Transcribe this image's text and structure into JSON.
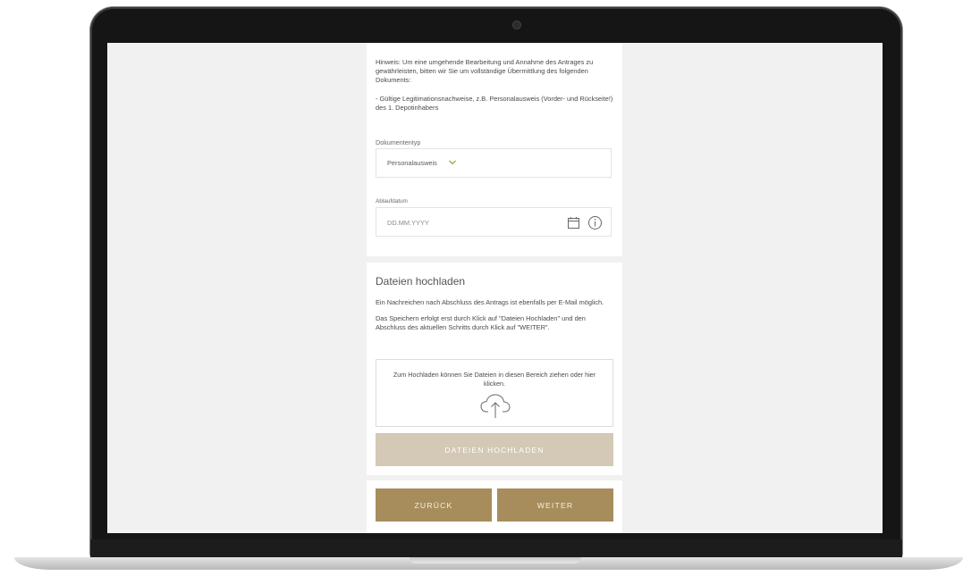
{
  "notice": {
    "paragraph1": "Hinweis: Um eine umgehende Bearbeitung und Annahme des Antrages zu gewährleisten, bitten wir Sie um vollständige Übermittlung des folgenden Dokuments:",
    "paragraph2": "- Gültige Legitimationsnachweise, z.B. Personalausweis (Vorder- und Rückseite!) des 1. Depotinhabers"
  },
  "document_type": {
    "label": "Dokumententyp",
    "selected": "Personalausweis"
  },
  "expiry_date": {
    "label": "Ablaufdatum",
    "placeholder": "DD.MM.YYYY"
  },
  "upload": {
    "title": "Dateien hochladen",
    "text1": "Ein Nachreichen nach Abschluss des Antrags ist ebenfalls per E-Mail möglich.",
    "text2": "Das Speichern erfolgt erst durch Klick auf \"Dateien Hochladen\" und den Abschluss des aktuellen Schritts durch Klick auf \"WEITER\".",
    "dropzone_text": "Zum Hochladen können Sie Dateien in diesen Bereich ziehen oder hier klicken.",
    "button_label": "DATEIEN HOCHLADEN"
  },
  "navigation": {
    "back_label": "ZURÜCK",
    "next_label": "WEITER"
  },
  "colors": {
    "accent": "#a78d5c",
    "accent_disabled": "#d4c8b6",
    "chevron": "#8fae3c"
  },
  "icons": [
    "chevron-down-icon",
    "calendar-icon",
    "info-icon",
    "cloud-upload-icon",
    "camera-icon"
  ]
}
